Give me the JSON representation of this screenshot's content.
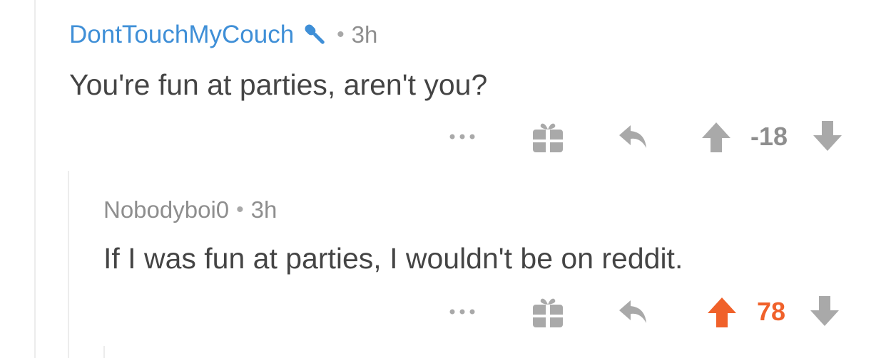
{
  "colors": {
    "author_link": "#3f8fd7",
    "muted_text": "#8e8e8e",
    "icon_gray": "#a9a9a9",
    "upvote_orange": "#f0612a"
  },
  "comments": [
    {
      "author": "DontTouchMyCouch",
      "flair_icon": "microphone-icon",
      "separator": "•",
      "age": "3h",
      "body": "You're fun at parties, aren't you?",
      "score": "-18",
      "vote_state": "none"
    },
    {
      "author": "Nobodyboi0",
      "separator": "•",
      "age": "3h",
      "body": "If I was fun at parties, I wouldn't be on reddit.",
      "score": "78",
      "vote_state": "upvoted"
    }
  ]
}
